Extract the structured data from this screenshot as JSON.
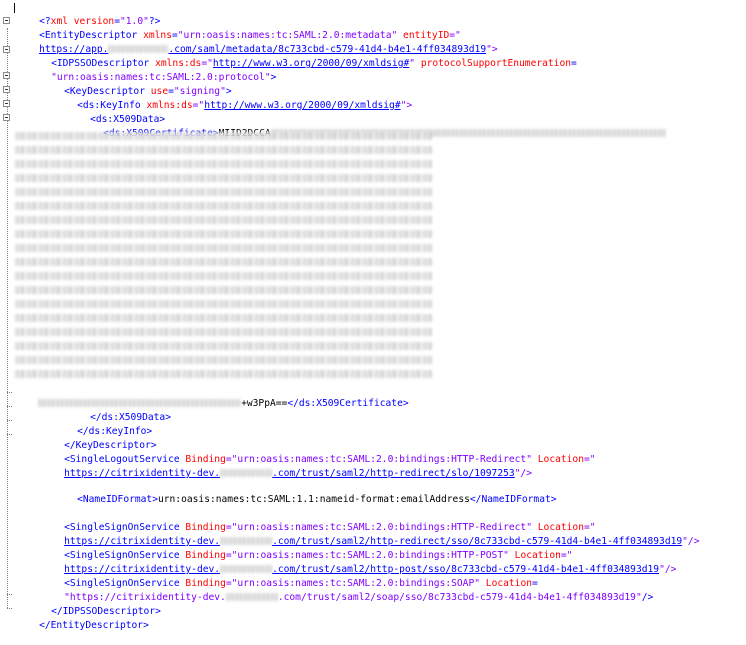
{
  "line1": {
    "open": "<?",
    "name": "xml",
    "attr": "version",
    "eq": "=",
    "val": "\"1.0\"",
    "close": "?>"
  },
  "line2": {
    "tag": "<EntityDescriptor",
    "attr1": "xmlns",
    "val1": "\"urn:oasis:names:tc:SAML:2.0:metadata\"",
    "attr2": "entityID",
    "eq": "=\""
  },
  "line3": {
    "link_prefix": "https://app.",
    "link_suffix": ".com/saml/metadata/8c733cbd-c579-41d4-b4e1-4ff034893d19",
    "end": "\">"
  },
  "line4": {
    "tag": "<IDPSSODescriptor",
    "attr1": "xmlns:ds",
    "eq1": "=\"",
    "link": "http://www.w3.org/2000/09/xmldsig#",
    "q": "\"",
    "attr2": "protocolSupportEnumeration",
    "eq2": "="
  },
  "line5": {
    "val": "\"urn:oasis:names:tc:SAML:2.0:protocol\"",
    "end": ">"
  },
  "line6": {
    "tag": "<KeyDescriptor",
    "attr": "use",
    "eq": "=",
    "val": "\"signing\"",
    "end": ">"
  },
  "line7": {
    "tag": "<ds:KeyInfo",
    "attr": "xmlns:ds",
    "eq": "=\"",
    "link": "http://www.w3.org/2000/09/xmldsig#",
    "end": "\">"
  },
  "line8": {
    "tag": "<ds:X509Data>"
  },
  "line9": {
    "tag": "<ds:X509Certificate>",
    "text": "MIID2DCCA"
  },
  "line10": {
    "text": "+w3PpA==",
    "tag": "</ds:X509Certificate>"
  },
  "line11": {
    "tag": "</ds:X509Data>"
  },
  "line12": {
    "tag": "</ds:KeyInfo>"
  },
  "line13": {
    "tag": "</KeyDescriptor>"
  },
  "line14": {
    "tag": "<SingleLogoutService",
    "attr1": "Binding",
    "val1": "=\"urn:oasis:names:tc:SAML:2.0:bindings:HTTP-Redirect\"",
    "attr2": "Location",
    "eq": "=\""
  },
  "line15": {
    "link_prefix": "https://citrixidentity-dev.",
    "link_suffix": ".com/trust/saml2/http-redirect/slo/1097253",
    "end": "\"/>"
  },
  "line16": {
    "open": "<NameIDFormat>",
    "text": "urn:oasis:names:tc:SAML:1.1:nameid-format:emailAddress",
    "close": "</NameIDFormat>"
  },
  "line17": {
    "tag": "<SingleSignOnService",
    "attr1": "Binding",
    "val1": "=\"urn:oasis:names:tc:SAML:2.0:bindings:HTTP-Redirect\"",
    "attr2": "Location",
    "eq": "=\""
  },
  "line18": {
    "link_prefix": "https://citrixidentity-dev.",
    "link_suffix": ".com/trust/saml2/http-redirect/sso/8c733cbd-c579-41d4-b4e1-4ff034893d19",
    "end": "\"/>"
  },
  "line19": {
    "tag": "<SingleSignOnService",
    "attr1": "Binding",
    "val1": "=\"urn:oasis:names:tc:SAML:2.0:bindings:HTTP-POST\"",
    "attr2": "Location",
    "eq": "=\""
  },
  "line20": {
    "link_prefix": "https://citrixidentity-dev.",
    "link_suffix": ".com/trust/saml2/http-post/sso/8c733cbd-c579-41d4-b4e1-4ff034893d19",
    "end": "\"/>"
  },
  "line21": {
    "tag": "<SingleSignOnService",
    "attr1": "Binding",
    "val1": "=\"urn:oasis:names:tc:SAML:2.0:bindings:SOAP\"",
    "attr2": "Location",
    "eq": "="
  },
  "line22": {
    "val_prefix": "\"https://citrixidentity-dev.",
    "val_suffix": ".com/trust/saml2/soap/sso/8c733cbd-c579-41d4-b4e1-4ff034893d19\"",
    "end": "/>"
  },
  "line23": {
    "tag": "</IDPSSODescriptor>"
  },
  "line24": {
    "tag": "</EntityDescriptor>"
  },
  "colors": {
    "tag": "#0000ff",
    "attr": "#ff0000",
    "value": "#8000ff",
    "text": "#000000"
  }
}
